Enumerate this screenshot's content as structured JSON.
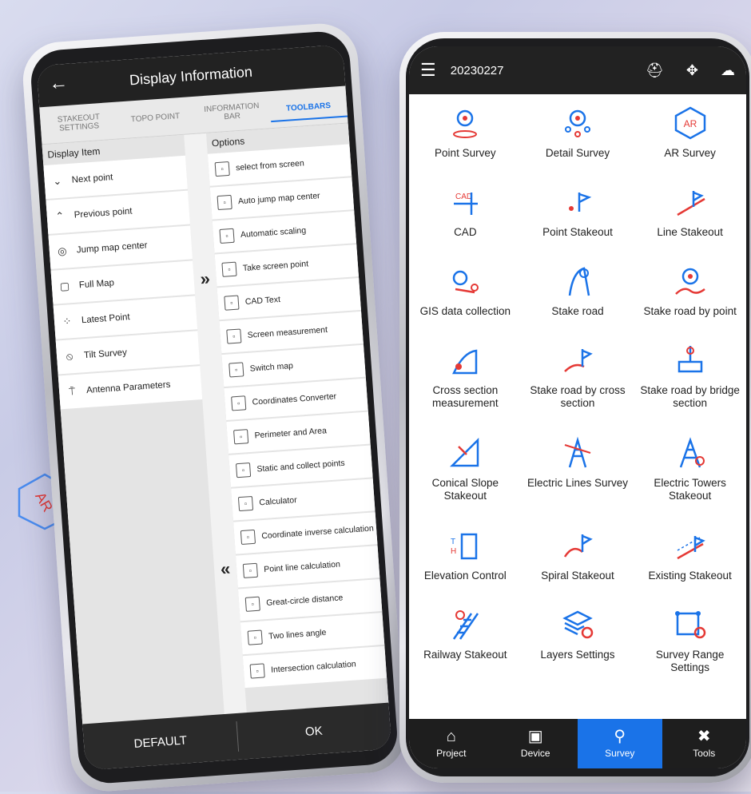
{
  "left": {
    "title": "Display Information",
    "tabs": [
      {
        "label": "STAKEOUT SETTINGS"
      },
      {
        "label": "TOPO POINT"
      },
      {
        "label": "INFORMATION BAR"
      },
      {
        "label": "TOOLBARS"
      }
    ],
    "display_header": "Display Item",
    "options_header": "Options",
    "display_items": [
      {
        "label": "Next point",
        "icon": "next-point-icon"
      },
      {
        "label": "Previous point",
        "icon": "previous-point-icon"
      },
      {
        "label": "Jump map center",
        "icon": "jump-map-center-icon"
      },
      {
        "label": "Full Map",
        "icon": "full-map-icon"
      },
      {
        "label": "Latest Point",
        "icon": "latest-point-icon"
      },
      {
        "label": "Tilt Survey",
        "icon": "tilt-survey-icon"
      },
      {
        "label": "Antenna Parameters",
        "icon": "antenna-parameters-icon"
      }
    ],
    "options": [
      {
        "label": "select from screen"
      },
      {
        "label": "Auto jump map center"
      },
      {
        "label": "Automatic scaling"
      },
      {
        "label": "Take screen point"
      },
      {
        "label": "CAD Text"
      },
      {
        "label": "Screen measurement"
      },
      {
        "label": "Switch map"
      },
      {
        "label": "Coordinates Converter"
      },
      {
        "label": "Perimeter and Area"
      },
      {
        "label": "Static and collect points"
      },
      {
        "label": "Calculator"
      },
      {
        "label": "Coordinate inverse calculation"
      },
      {
        "label": "Point line calculation"
      },
      {
        "label": "Great-circle distance"
      },
      {
        "label": "Two lines angle"
      },
      {
        "label": "Intersection calculation"
      }
    ],
    "add_arrow": "»",
    "remove_arrow": "«",
    "footer": {
      "default_label": "DEFAULT",
      "ok_label": "OK"
    }
  },
  "right": {
    "date": "20230227",
    "items": [
      {
        "label": "Point Survey"
      },
      {
        "label": "Detail Survey"
      },
      {
        "label": "AR Survey"
      },
      {
        "label": "CAD"
      },
      {
        "label": "Point Stakeout"
      },
      {
        "label": "Line Stakeout"
      },
      {
        "label": "GIS data collection"
      },
      {
        "label": "Stake road"
      },
      {
        "label": "Stake road by point"
      },
      {
        "label": "Cross section measurement"
      },
      {
        "label": "Stake road by cross section"
      },
      {
        "label": "Stake road by bridge section"
      },
      {
        "label": "Conical Slope Stakeout"
      },
      {
        "label": "Electric Lines Survey"
      },
      {
        "label": "Electric Towers Stakeout"
      },
      {
        "label": "Elevation Control"
      },
      {
        "label": "Spiral Stakeout"
      },
      {
        "label": "Existing Stakeout"
      },
      {
        "label": "Railway Stakeout"
      },
      {
        "label": "Layers Settings"
      },
      {
        "label": "Survey Range Settings"
      }
    ],
    "nav": [
      {
        "label": "Project"
      },
      {
        "label": "Device"
      },
      {
        "label": "Survey"
      },
      {
        "label": "Tools"
      }
    ],
    "colors": {
      "accent": "#1a73e8",
      "icon_red": "#e53935",
      "icon_blue": "#1a73e8"
    }
  },
  "float_icon": {
    "label": "AR"
  }
}
